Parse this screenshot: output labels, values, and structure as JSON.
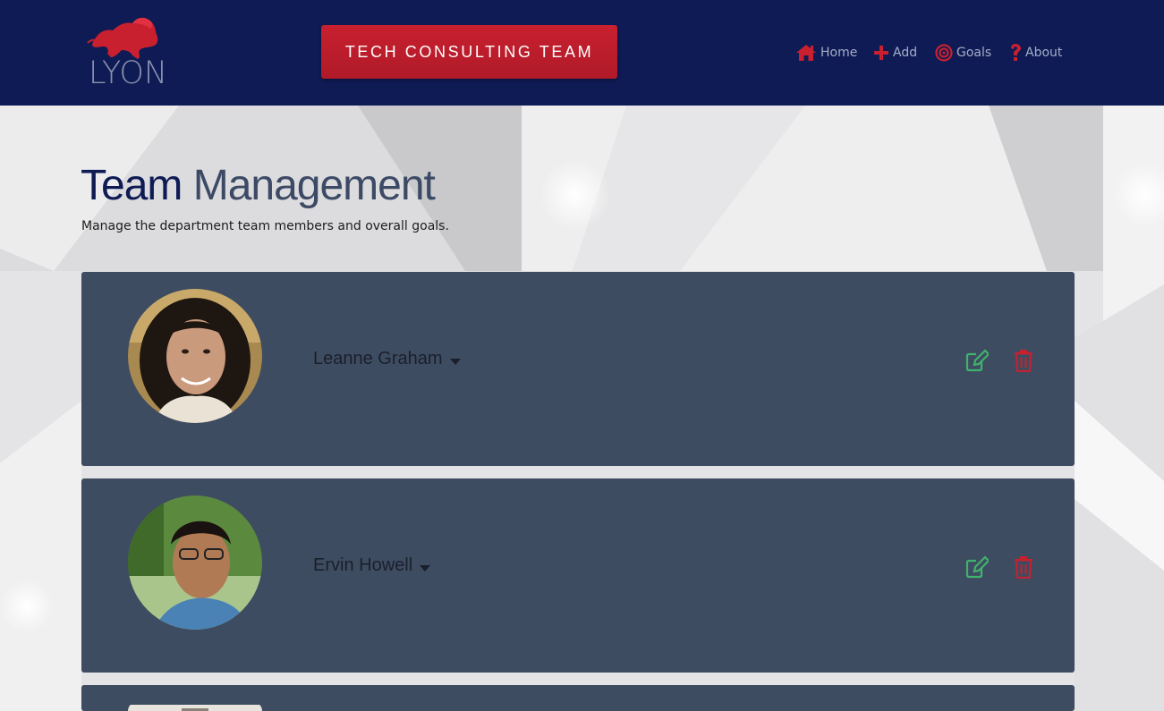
{
  "header": {
    "logo_text": "LYON",
    "team_button": "TECH CONSULTING TEAM",
    "nav": [
      {
        "label": "Home",
        "icon": "home-icon"
      },
      {
        "label": "Add",
        "icon": "plus-icon"
      },
      {
        "label": "Goals",
        "icon": "target-icon"
      },
      {
        "label": "About",
        "icon": "question-icon"
      }
    ],
    "colors": {
      "bar": "#0e1b54",
      "accent": "#c8202f",
      "nav_text": "#a7adc7"
    }
  },
  "page": {
    "title_part1": "Team",
    "title_part2": "Management",
    "subtitle": "Manage the department team members and overall goals."
  },
  "members": [
    {
      "name": "Leanne Graham",
      "avatar": "avatar-woman"
    },
    {
      "name": "Ervin Howell",
      "avatar": "avatar-man"
    },
    {
      "name": "",
      "avatar": "avatar-partial"
    }
  ],
  "colors": {
    "card": "#3e4c61",
    "edit": "#3fb36b",
    "delete": "#c8202f"
  }
}
